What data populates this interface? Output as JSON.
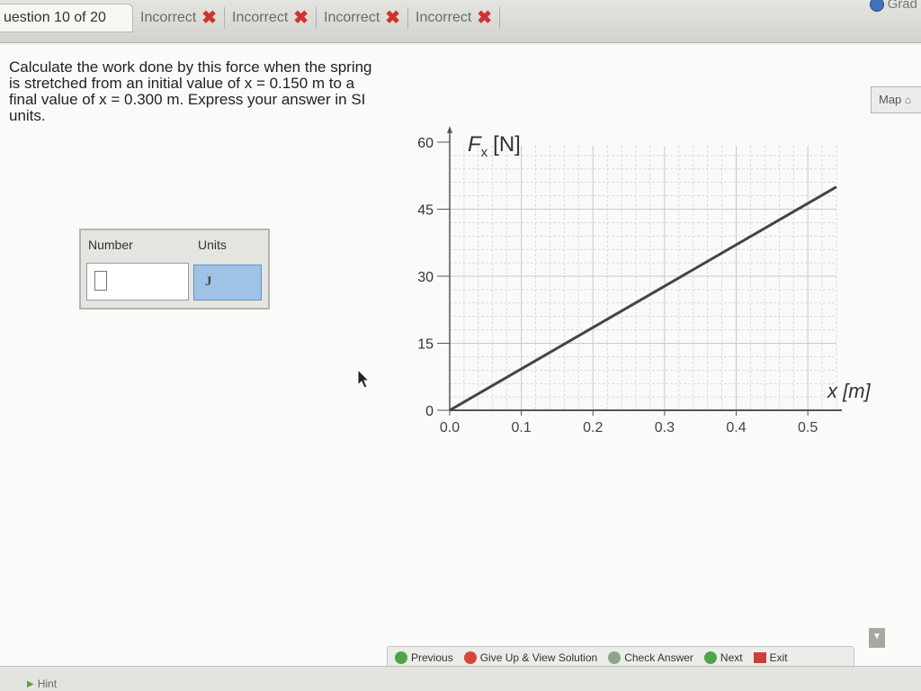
{
  "header": {
    "question_tab": "uestion 10 of 20",
    "status_tabs": [
      {
        "label": "Incorrect",
        "icon": "x-icon"
      },
      {
        "label": "Incorrect",
        "icon": "x-icon"
      },
      {
        "label": "Incorrect",
        "icon": "x-icon"
      },
      {
        "label": "Incorrect",
        "icon": "x-icon"
      }
    ],
    "grade_label": "Grad"
  },
  "question": {
    "text": "Calculate the work done by this force when the spring is stretched from an initial value of x = 0.150 m to a final value of x = 0.300 m. Express your answer in SI units."
  },
  "map_button": {
    "label": "Map",
    "icon": "map-icon"
  },
  "answer": {
    "number_label": "Number",
    "units_label": "Units",
    "number_value": "",
    "units_value": "J"
  },
  "chart_data": {
    "type": "line",
    "ylabel_main": "F",
    "ylabel_sub": "x",
    "ylabel_unit": "[N]",
    "xlabel": "x [m]",
    "x_ticks": [
      "0.0",
      "0.1",
      "0.2",
      "0.3",
      "0.4",
      "0.5"
    ],
    "y_ticks": [
      "0",
      "15",
      "30",
      "45",
      "60"
    ],
    "xlim": [
      0,
      0.54
    ],
    "ylim": [
      0,
      60
    ],
    "grid": true,
    "series": [
      {
        "x": [
          0,
          0.54
        ],
        "y": [
          0,
          50
        ]
      }
    ],
    "colors": {
      "line": "#444444",
      "grid": "#c8c8c8",
      "axis": "#555555"
    }
  },
  "footer": {
    "hint_label": "Hint",
    "previous_label": "Previous",
    "give_up_label": "Give Up & View Solution",
    "check_label": "Check Answer",
    "next_label": "Next",
    "exit_label": "Exit"
  }
}
